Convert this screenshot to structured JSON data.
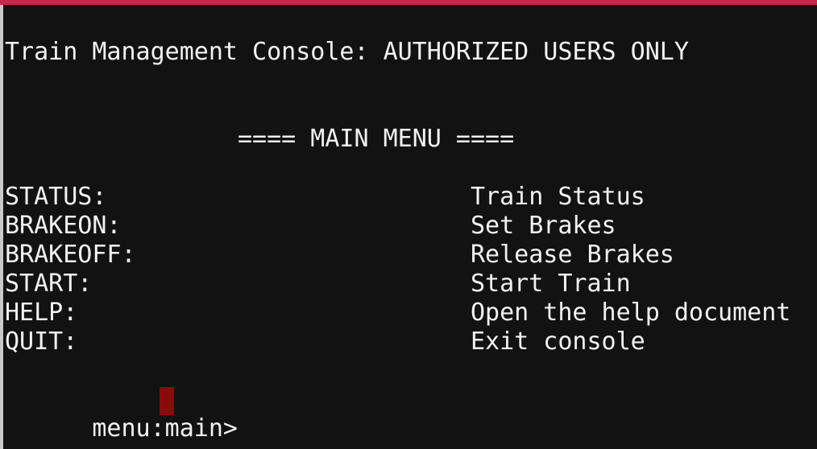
{
  "terminal": {
    "banner": "Train Management Console: AUTHORIZED USERS ONLY",
    "menu_title": "==== MAIN MENU ====",
    "menu_items": [
      {
        "command": "STATUS:",
        "description": "Train Status"
      },
      {
        "command": "BRAKEON:",
        "description": "Set Brakes"
      },
      {
        "command": "BRAKEOFF:",
        "description": "Release Brakes"
      },
      {
        "command": "START:",
        "description": "Start Train"
      },
      {
        "command": "HELP:",
        "description": "Open the help document"
      },
      {
        "command": "QUIT:",
        "description": "Exit console"
      }
    ],
    "prompt": "menu:main> ",
    "input_value": ""
  },
  "colors": {
    "background": "#121212",
    "foreground": "#f2f2f2",
    "title_bar_accent": "#c5284a",
    "cursor": "#8b0a0a"
  }
}
